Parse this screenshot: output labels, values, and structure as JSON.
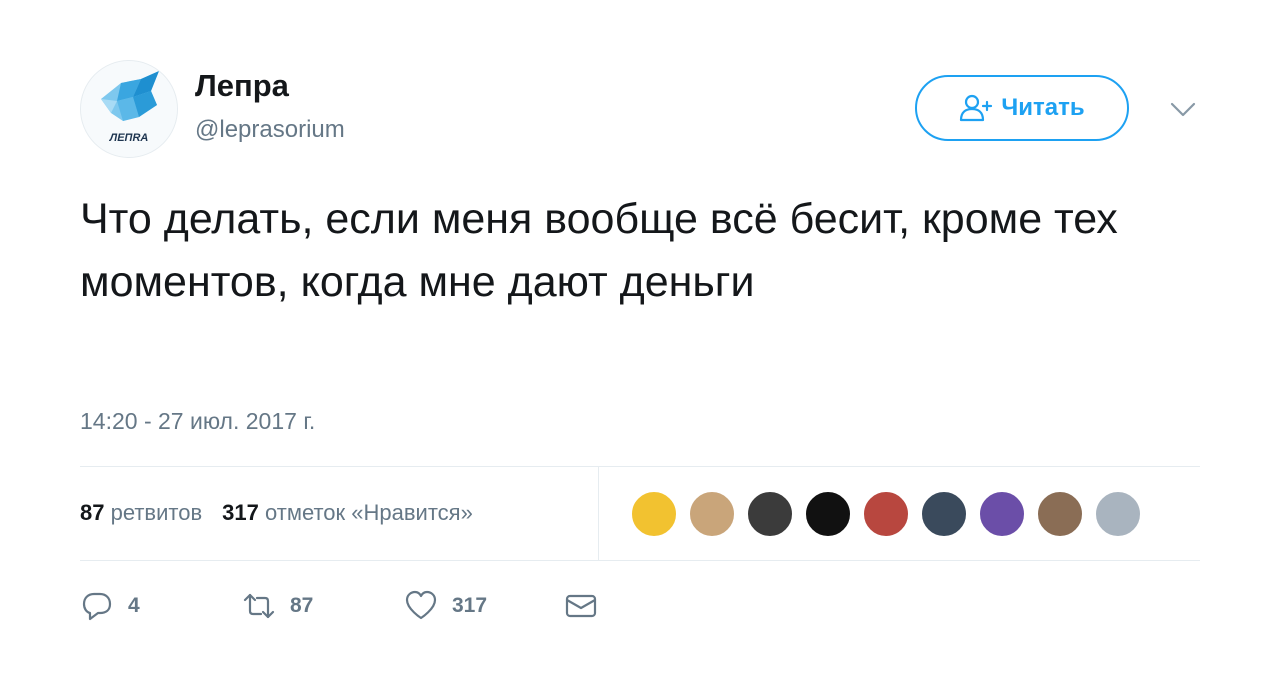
{
  "author": {
    "name": "Лепра",
    "handle": "@leprasorium",
    "logo_text": "ЛЕПRA"
  },
  "follow": {
    "label": "Читать"
  },
  "tweet": {
    "text": "Что делать, если меня вообще всё бесит, кроме тех моментов, когда мне дают деньги",
    "timestamp": "14:20 - 27 июл. 2017 г."
  },
  "stats": {
    "retweets_count": "87",
    "retweets_label": "ретвитов",
    "likes_count": "317",
    "likes_label": "отметок «Нравится»"
  },
  "likers_colors": [
    "#f2c230",
    "#c9a57a",
    "#3b3b3b",
    "#111111",
    "#b8473f",
    "#3a4a5c",
    "#6b4ea8",
    "#8a6d55",
    "#a9b4bf"
  ],
  "actions": {
    "replies": "4",
    "retweets": "87",
    "likes": "317"
  },
  "colors": {
    "accent": "#1da1f2",
    "muted": "#657786",
    "text": "#14171a",
    "border": "#e6ecf0"
  }
}
